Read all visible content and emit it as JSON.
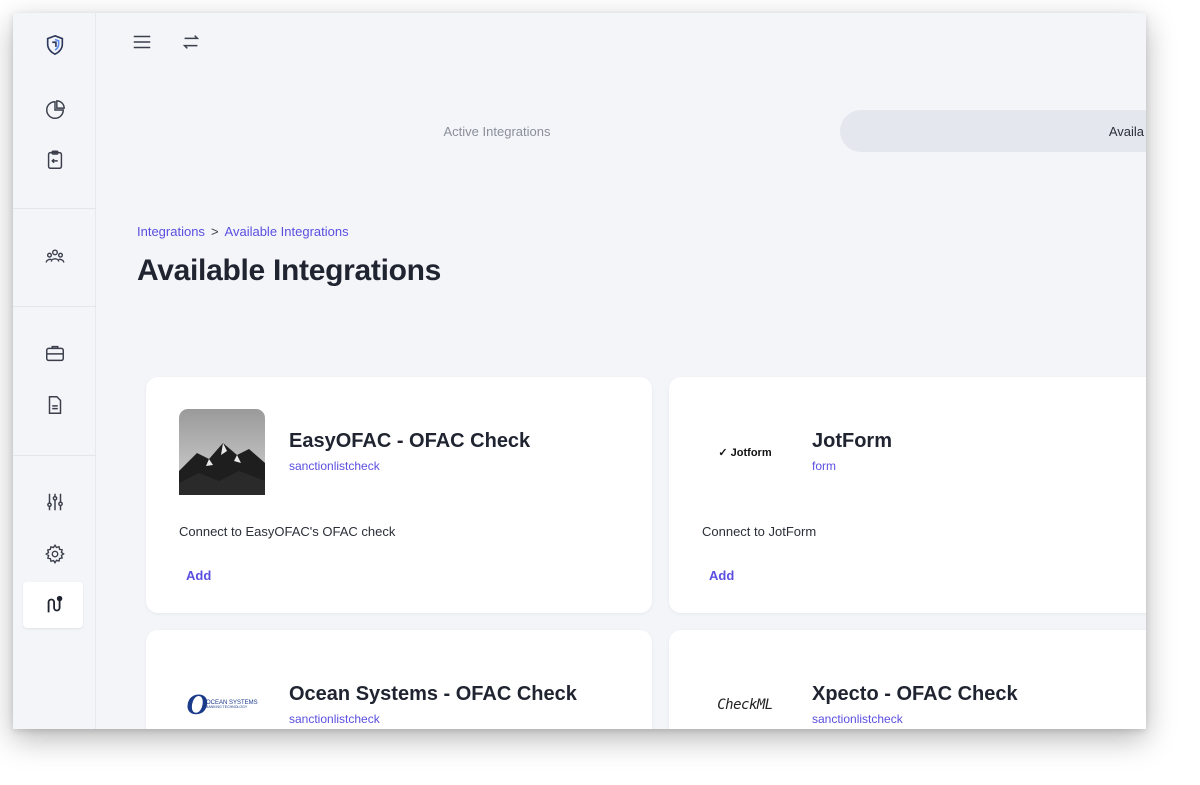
{
  "topbar": {
    "menu_icon": "hamburger-menu-icon",
    "switch_icon": "swap-arrows-icon"
  },
  "sidebar": {
    "items": [
      {
        "icon": "shield-logo-icon"
      },
      {
        "icon": "pie-chart-icon"
      },
      {
        "icon": "clipboard-icon"
      },
      {
        "icon": "users-group-icon"
      },
      {
        "icon": "briefcase-icon"
      },
      {
        "icon": "document-icon"
      },
      {
        "icon": "sliders-icon"
      },
      {
        "icon": "gear-icon"
      },
      {
        "icon": "integrations-icon",
        "active": true
      }
    ]
  },
  "tabs": {
    "active_integrations": "Active Integrations",
    "available_integrations": "Availa"
  },
  "breadcrumb": {
    "root": "Integrations",
    "separator": ">",
    "current": "Available Integrations"
  },
  "page_title": "Available Integrations",
  "cards": [
    {
      "name": "EasyOFAC - OFAC Check",
      "category": "sanctionlistcheck",
      "description": "Connect to EasyOFAC's OFAC check",
      "add_label": "Add",
      "logo": "mountain-photo"
    },
    {
      "name": "JotForm",
      "category": "form",
      "description": "Connect to JotForm",
      "add_label": "Add",
      "logo": "jotform-logo",
      "logo_text": "Jotform"
    },
    {
      "name": "Ocean Systems - OFAC Check",
      "category": "sanctionlistcheck",
      "description": "",
      "add_label": "",
      "logo": "ocean-systems-logo",
      "logo_text": "OCEAN SYSTEMS",
      "logo_subtext": "BANKING TECHNOLOGY"
    },
    {
      "name": "Xpecto - OFAC Check",
      "category": "sanctionlistcheck",
      "description": "",
      "add_label": "",
      "logo": "checkml-logo",
      "logo_text": "CheckML"
    }
  ],
  "colors": {
    "accent": "#5b4fe0",
    "background": "#f3f5f9",
    "card": "#ffffff",
    "title": "#1f2430"
  }
}
